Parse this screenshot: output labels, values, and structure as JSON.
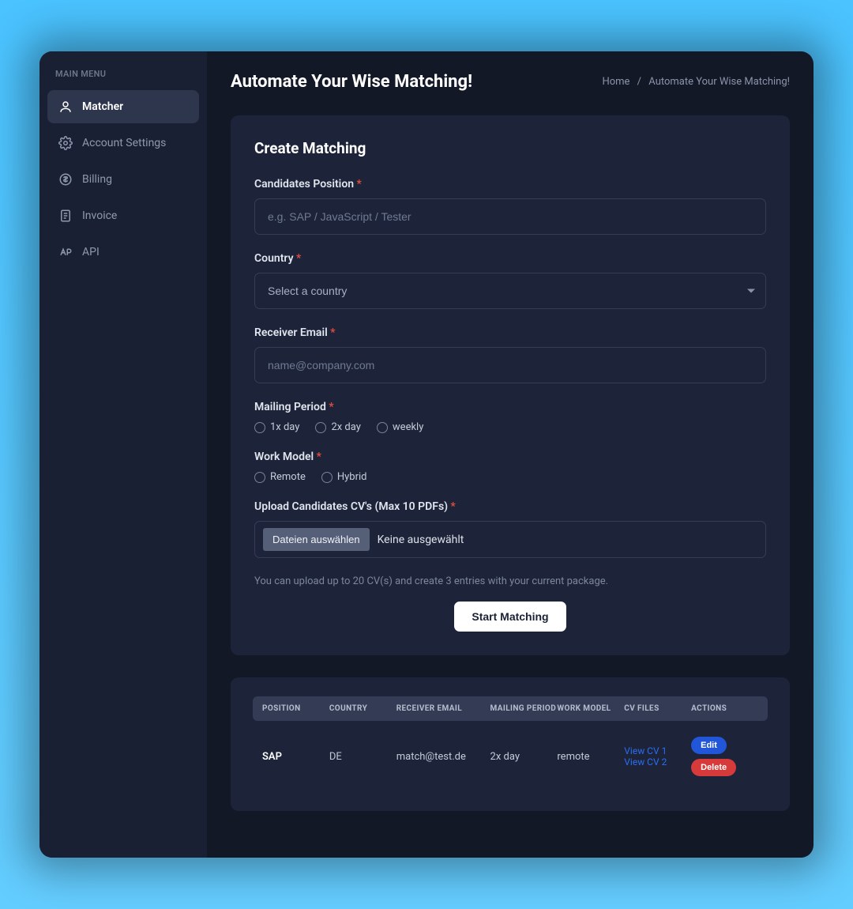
{
  "sidebar": {
    "title": "MAIN MENU",
    "items": [
      {
        "label": "Matcher"
      },
      {
        "label": "Account Settings"
      },
      {
        "label": "Billing"
      },
      {
        "label": "Invoice"
      },
      {
        "label": "API"
      }
    ]
  },
  "header": {
    "title": "Automate Your Wise Matching!",
    "breadcrumb_home": "Home",
    "breadcrumb_current": "Automate Your Wise Matching!"
  },
  "form": {
    "card_title": "Create Matching",
    "position_label": "Candidates Position",
    "position_placeholder": "e.g. SAP / JavaScript / Tester",
    "country_label": "Country",
    "country_placeholder": "Select a country",
    "email_label": "Receiver Email",
    "email_placeholder": "name@company.com",
    "mailing_label": "Mailing Period",
    "mailing_options": [
      "1x day",
      "2x day",
      "weekly"
    ],
    "work_label": "Work Model",
    "work_options": [
      "Remote",
      "Hybrid"
    ],
    "upload_label": "Upload Candidates CV's (Max 10 PDFs)",
    "file_button": "Dateien auswählen",
    "file_status": "Keine ausgewählt",
    "hint": "You can upload up to 20 CV(s) and create 3 entries with your current package.",
    "submit": "Start Matching"
  },
  "table": {
    "headers": [
      "POSITION",
      "COUNTRY",
      "RECEIVER EMAIL",
      "MAILING PERIOD",
      "WORK MODEL",
      "CV FILES",
      "ACTIONS"
    ],
    "rows": [
      {
        "position": "SAP",
        "country": "DE",
        "email": "match@test.de",
        "mailing": "2x day",
        "work": "remote",
        "cv_links": [
          "View CV 1",
          "View CV 2"
        ],
        "edit": "Edit",
        "delete": "Delete"
      }
    ]
  }
}
